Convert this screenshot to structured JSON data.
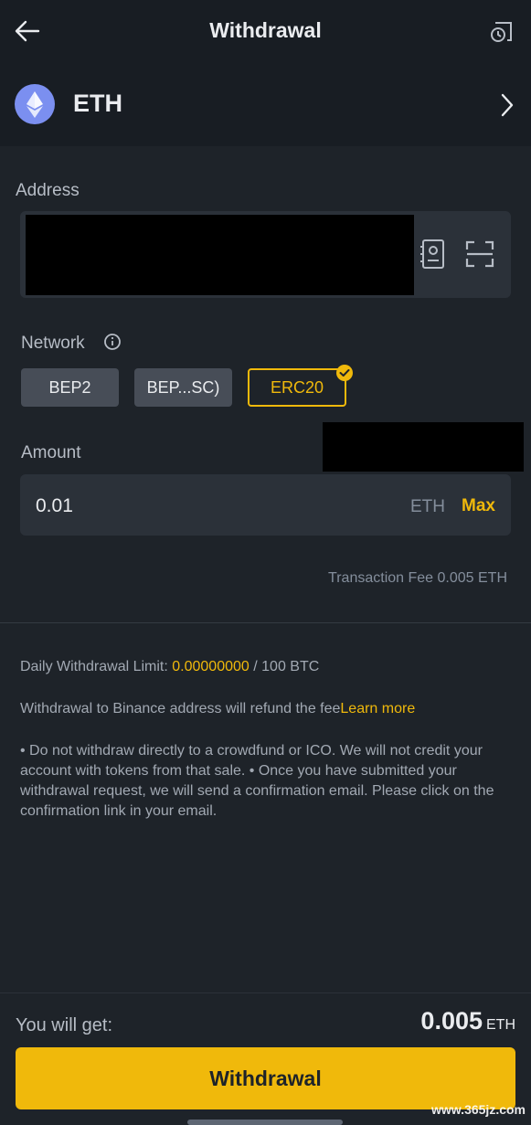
{
  "header": {
    "title": "Withdrawal",
    "back_icon": "arrow-left-icon",
    "history_icon": "history-icon"
  },
  "coin": {
    "symbol": "ETH",
    "icon": "ethereum-icon"
  },
  "address": {
    "label": "Address",
    "value": ""
  },
  "network": {
    "label": "Network",
    "options": [
      "BEP2",
      "BEP...SC)",
      "ERC20"
    ],
    "selected": "ERC20"
  },
  "amount": {
    "label": "Amount",
    "value": "0.01",
    "unit": "ETH",
    "max_label": "Max"
  },
  "fee": {
    "label": "Transaction Fee",
    "value": "0.005 ETH"
  },
  "limits": {
    "label": "Daily Withdrawal Limit:",
    "used": "0.00000000",
    "total": "/ 100 BTC"
  },
  "refund_note": {
    "text": "Withdrawal to Binance address will refund the fee",
    "link": "Learn more"
  },
  "disclaimer": "• Do not withdraw directly to a crowdfund or ICO. We will not credit your account with tokens from that sale. • Once you have submitted your withdrawal request, we will send a confirmation email. Please click on the confirmation link in your email.",
  "footer": {
    "get_label": "You will get:",
    "get_amount": "0.005",
    "get_unit": "ETH",
    "button_label": "Withdrawal"
  },
  "watermark": "www.365jz.com",
  "colors": {
    "accent": "#f0b90b",
    "background": "#1e2329",
    "panel": "#2b3139"
  }
}
